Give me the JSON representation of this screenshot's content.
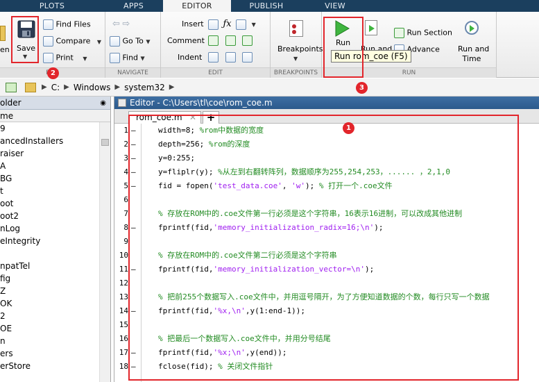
{
  "tabs": [
    "PLOTS",
    "APPS",
    "EDITOR",
    "PUBLISH",
    "VIEW"
  ],
  "active_tab": "EDITOR",
  "toolstrip": {
    "file": {
      "label": "FILE",
      "open_partial": "en",
      "save": "Save",
      "find_files": "Find Files",
      "compare": "Compare",
      "print": "Print"
    },
    "navigate": {
      "label": "NAVIGATE",
      "go_to": "Go To",
      "find": "Find"
    },
    "edit": {
      "label": "EDIT",
      "insert": "Insert",
      "comment": "Comment",
      "indent": "Indent"
    },
    "breakpoints": {
      "label": "BREAKPOINTS",
      "breakpoints": "Breakpoints"
    },
    "run": {
      "label": "RUN",
      "run": "Run",
      "run_and_advance_partial": "Run and",
      "run_section": "Run Section",
      "advance": "Advance",
      "run_and_time_1": "Run and",
      "run_and_time_2": "Time"
    }
  },
  "tooltip": "Run rom_coe (F5)",
  "address": {
    "drive": "C:",
    "parts": [
      "Windows",
      "system32"
    ]
  },
  "left_panel": {
    "header": "older",
    "column": "me",
    "items": [
      "9",
      "ancedInstallers",
      "raiser",
      "A",
      "BG",
      "t",
      "oot",
      "oot2",
      "nLog",
      "eIntegrity",
      "",
      "npatTel",
      "fig",
      "Z",
      "OK",
      "2",
      "OE",
      "n",
      "ers",
      "erStore"
    ]
  },
  "editor": {
    "title": "Editor - C:\\Users\\tl\\coe\\rom_coe.m",
    "file_tab": "rom_coe.m",
    "add_tab": "+",
    "lines": [
      {
        "n": "1",
        "dash": true,
        "segs": [
          {
            "t": "width=8;   ",
            "c": ""
          },
          {
            "t": "%rom中数据的宽度",
            "c": "cm"
          }
        ]
      },
      {
        "n": "2",
        "dash": true,
        "segs": [
          {
            "t": "depth=256; ",
            "c": ""
          },
          {
            "t": "%rom的深度",
            "c": "cm"
          }
        ]
      },
      {
        "n": "3",
        "dash": true,
        "segs": [
          {
            "t": "y=0:255;",
            "c": ""
          }
        ]
      },
      {
        "n": "4",
        "dash": true,
        "segs": [
          {
            "t": "y=fliplr(y); ",
            "c": ""
          },
          {
            "t": "%从左到右翻转阵列，数据顺序为255,254,253，......  ，2,1,0",
            "c": "cm"
          }
        ]
      },
      {
        "n": "5",
        "dash": true,
        "segs": [
          {
            "t": "fid = fopen(",
            "c": ""
          },
          {
            "t": "'test_data.coe'",
            "c": "st"
          },
          {
            "t": ", ",
            "c": ""
          },
          {
            "t": "'w'",
            "c": "st"
          },
          {
            "t": "); ",
            "c": ""
          },
          {
            "t": "% 打开一个.coe文件",
            "c": "cm"
          }
        ]
      },
      {
        "n": "6",
        "dash": false,
        "segs": []
      },
      {
        "n": "7",
        "dash": false,
        "segs": [
          {
            "t": "% 存放在ROM中的.coe文件第一行必须是这个字符串，16表示16进制，可以改成其他进制",
            "c": "cm"
          }
        ]
      },
      {
        "n": "8",
        "dash": true,
        "segs": [
          {
            "t": "fprintf(fid,",
            "c": ""
          },
          {
            "t": "'memory_initialization_radix=16;\\n'",
            "c": "st"
          },
          {
            "t": ");",
            "c": ""
          }
        ]
      },
      {
        "n": "9",
        "dash": false,
        "segs": []
      },
      {
        "n": "10",
        "dash": false,
        "segs": [
          {
            "t": "% 存放在ROM中的.coe文件第二行必须是这个字符串",
            "c": "cm"
          }
        ]
      },
      {
        "n": "11",
        "dash": true,
        "segs": [
          {
            "t": "fprintf(fid,",
            "c": ""
          },
          {
            "t": "'memory_initialization_vector=\\n'",
            "c": "st"
          },
          {
            "t": ");",
            "c": ""
          }
        ]
      },
      {
        "n": "12",
        "dash": false,
        "segs": []
      },
      {
        "n": "13",
        "dash": false,
        "segs": [
          {
            "t": "% 把前255个数据写入.coe文件中，并用逗号隔开，为了方便知道数据的个数，每行只写一个数据",
            "c": "cm"
          }
        ]
      },
      {
        "n": "14",
        "dash": true,
        "segs": [
          {
            "t": "fprintf(fid,",
            "c": ""
          },
          {
            "t": "'%x,\\n'",
            "c": "st"
          },
          {
            "t": ",y(1:end-1));",
            "c": ""
          }
        ]
      },
      {
        "n": "15",
        "dash": false,
        "segs": []
      },
      {
        "n": "16",
        "dash": false,
        "segs": [
          {
            "t": "% 把最后一个数据写入.coe文件中，并用分号结尾",
            "c": "cm"
          }
        ]
      },
      {
        "n": "17",
        "dash": true,
        "segs": [
          {
            "t": "fprintf(fid,",
            "c": ""
          },
          {
            "t": "'%x;\\n'",
            "c": "st"
          },
          {
            "t": ",y(end));",
            "c": ""
          }
        ]
      },
      {
        "n": "18",
        "dash": true,
        "segs": [
          {
            "t": "fclose(fid);  ",
            "c": ""
          },
          {
            "t": "% 关闭文件指针",
            "c": "cm"
          }
        ]
      }
    ]
  },
  "badges": [
    "1",
    "2",
    "3"
  ],
  "colors": {
    "annotation": "#e2252b",
    "comment": "#228b22",
    "string": "#a020f0",
    "titlebar": "#2c5a8c"
  }
}
